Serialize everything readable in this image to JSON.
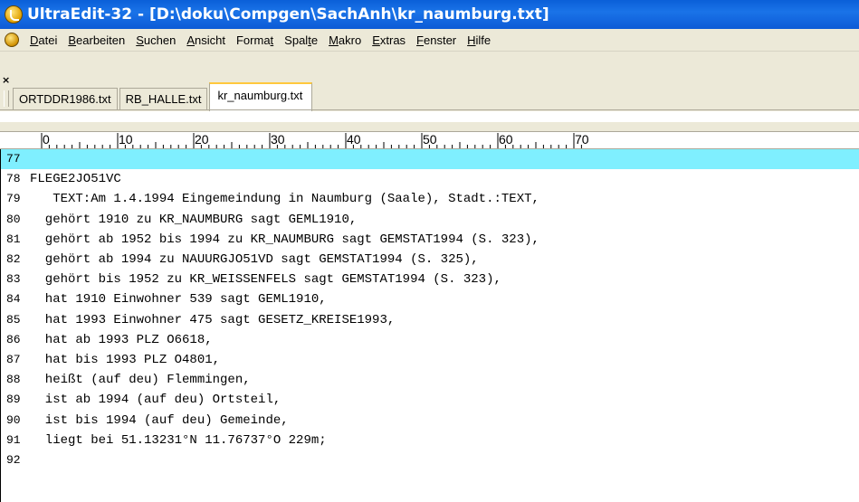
{
  "window": {
    "title": "UltraEdit-32 - [D:\\doku\\Compgen\\SachAnh\\kr_naumburg.txt]"
  },
  "menu": {
    "items": [
      {
        "pre": "",
        "u": "D",
        "post": "atei"
      },
      {
        "pre": "",
        "u": "B",
        "post": "earbeiten"
      },
      {
        "pre": "",
        "u": "S",
        "post": "uchen"
      },
      {
        "pre": "",
        "u": "A",
        "post": "nsicht"
      },
      {
        "pre": "Forma",
        "u": "t",
        "post": ""
      },
      {
        "pre": "Spal",
        "u": "t",
        "post": "e"
      },
      {
        "pre": "",
        "u": "M",
        "post": "akro"
      },
      {
        "pre": "",
        "u": "E",
        "post": "xtras"
      },
      {
        "pre": "",
        "u": "F",
        "post": "enster"
      },
      {
        "pre": "",
        "u": "H",
        "post": "ilfe"
      }
    ]
  },
  "tabs": [
    {
      "label": "ORTDDR1986.txt",
      "active": false
    },
    {
      "label": "RB_HALLE.txt",
      "active": false
    },
    {
      "label": "kr_naumburg.txt",
      "active": true
    }
  ],
  "ruler": {
    "labels": [
      "0",
      "10",
      "20",
      "30",
      "40",
      "50",
      "60",
      "70"
    ]
  },
  "editor": {
    "current_line": "77",
    "lines": [
      {
        "num": "77",
        "text": ""
      },
      {
        "num": "78",
        "text": "FLEGE2JO51VC"
      },
      {
        "num": "79",
        "text": "   TEXT:Am 1.4.1994 Eingemeindung in Naumburg (Saale), Stadt.:TEXT,"
      },
      {
        "num": "80",
        "text": "  gehört 1910 zu KR_NAUMBURG sagt GEML1910,"
      },
      {
        "num": "81",
        "text": "  gehört ab 1952 bis 1994 zu KR_NAUMBURG sagt GEMSTAT1994 (S. 323),"
      },
      {
        "num": "82",
        "text": "  gehört ab 1994 zu NAUURGJO51VD sagt GEMSTAT1994 (S. 325),"
      },
      {
        "num": "83",
        "text": "  gehört bis 1952 zu KR_WEISSENFELS sagt GEMSTAT1994 (S. 323),"
      },
      {
        "num": "84",
        "text": "  hat 1910 Einwohner 539 sagt GEML1910,"
      },
      {
        "num": "85",
        "text": "  hat 1993 Einwohner 475 sagt GESETZ_KREISE1993,"
      },
      {
        "num": "86",
        "text": "  hat ab 1993 PLZ O6618,"
      },
      {
        "num": "87",
        "text": "  hat bis 1993 PLZ O4801,"
      },
      {
        "num": "88",
        "text": "  heißt (auf deu) Flemmingen,"
      },
      {
        "num": "89",
        "text": "  ist ab 1994 (auf deu) Ortsteil,"
      },
      {
        "num": "90",
        "text": "  ist bis 1994 (auf deu) Gemeinde,"
      },
      {
        "num": "91",
        "text": "  liegt bei 51.13231°N 11.76737°O 229m;"
      },
      {
        "num": "92",
        "text": ""
      }
    ]
  },
  "colors": {
    "title_bar": "#1a73e8",
    "current_line_highlight": "#7fefff",
    "active_tab_accent": "#ffc83c"
  }
}
